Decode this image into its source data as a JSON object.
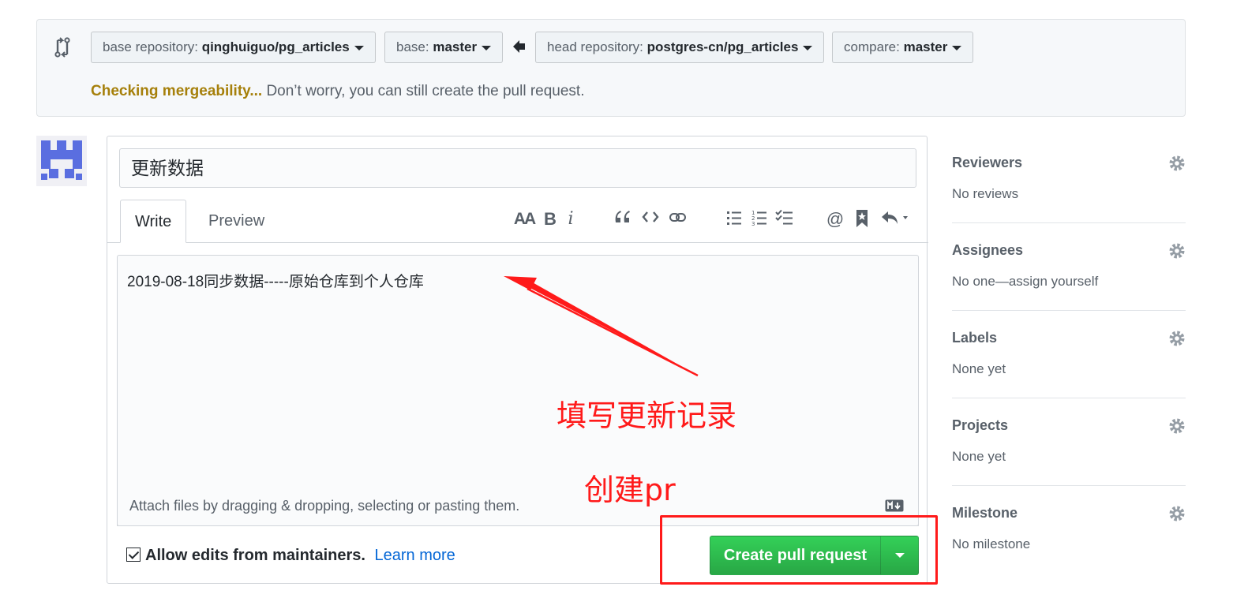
{
  "compare": {
    "base_repo_label": "base repository:",
    "base_repo_value": "qinghuiguo/pg_articles",
    "base_label": "base:",
    "base_value": "master",
    "head_repo_label": "head repository:",
    "head_repo_value": "postgres-cn/pg_articles",
    "compare_label": "compare:",
    "compare_value": "master",
    "status_checking": "Checking mergeability...",
    "status_message": "Don’t worry, you can still create the pull request."
  },
  "form": {
    "title_value": "更新数据",
    "tabs": [
      "Write",
      "Preview"
    ],
    "selected_tab": "Write",
    "body_value": "2019-08-18同步数据-----原始仓库到个人仓库",
    "drag_hint": "Attach files by dragging & dropping, selecting or pasting them.",
    "allow_edits_label": "Allow edits from maintainers.",
    "learn_more": "Learn more",
    "submit_label": "Create pull request"
  },
  "toolbar": {
    "text_size": "AA",
    "bold": "B",
    "italic": "i",
    "quote": "“",
    "mention": "@"
  },
  "sidebar": {
    "sections": [
      {
        "heading": "Reviewers",
        "value": "No reviews"
      },
      {
        "heading": "Assignees",
        "value": "No one—assign yourself"
      },
      {
        "heading": "Labels",
        "value": "None yet"
      },
      {
        "heading": "Projects",
        "value": "None yet"
      },
      {
        "heading": "Milestone",
        "value": "No milestone"
      }
    ]
  },
  "annotations": {
    "note_fill": "填写更新记录",
    "note_create": "创建pr",
    "color": "#ff1a1a"
  },
  "colors": {
    "create_button": "#28a745",
    "checking": "#a6800b",
    "link": "#0366d6"
  }
}
